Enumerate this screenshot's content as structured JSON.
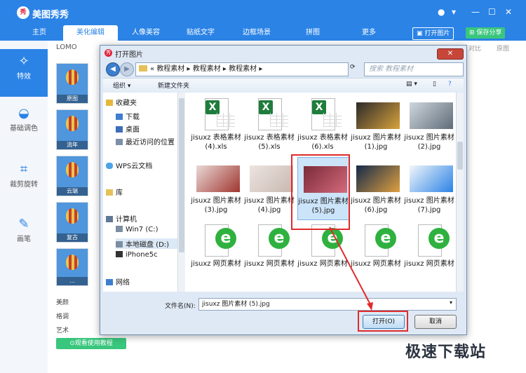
{
  "app": {
    "logo_text": "秀",
    "title": "美图秀秀",
    "controls": {
      "chat": "●",
      "menu": "▾",
      "minimize": "—",
      "maximize": "☐",
      "close": "✕"
    }
  },
  "tabs": [
    {
      "label": "主页"
    },
    {
      "label": "美化编辑"
    },
    {
      "label": "人像美容"
    },
    {
      "label": "贴纸文字"
    },
    {
      "label": "边框场景"
    },
    {
      "label": "拼图"
    },
    {
      "label": "更多"
    }
  ],
  "header_buttons": {
    "open": "打开图片",
    "save": "保存分享"
  },
  "sidebar": [
    {
      "label": "特效",
      "icon": "✧"
    },
    {
      "label": "基础调色",
      "icon": "◒"
    },
    {
      "label": "裁剪旋转",
      "icon": "⌗"
    },
    {
      "label": "画笔",
      "icon": "✎"
    }
  ],
  "effects": {
    "group": "LOMO",
    "thumbs": [
      "原图",
      "流年",
      "云端",
      "复古",
      "..."
    ],
    "categories": [
      "美颜",
      "格调",
      "艺术"
    ],
    "tutorial": "观看使用教程"
  },
  "top_right": {
    "compare": "对比",
    "contrast": "原图"
  },
  "dialog": {
    "title": "打开图片",
    "close": "✕",
    "nav": {
      "back": "◀",
      "forward": "▶"
    },
    "path": [
      "«",
      "教程素材",
      "▸",
      "教程素材",
      "▸",
      "教程素材",
      "▸"
    ],
    "search_placeholder": "搜索 教程素材",
    "toolbar": {
      "organize": "组织 ▾",
      "new_folder": "新建文件夹"
    },
    "nav_items": [
      {
        "label": "收藏夹",
        "color": "#e6b83a"
      },
      {
        "label": "下载",
        "color": "#3d7ed0"
      },
      {
        "label": "桌面",
        "color": "#3d6db8"
      },
      {
        "label": "最近访问的位置",
        "color": "#7c8fa6"
      },
      {
        "label": "WPS云文档",
        "color": "#4aa3e6"
      },
      {
        "label": "库",
        "color": "#e6c15a"
      },
      {
        "label": "计算机",
        "color": "#5f7896"
      },
      {
        "label": "Win7 (C:)",
        "color": "#7d8ea3"
      },
      {
        "label": "本地磁盘 (D:)",
        "color": "#7d8ea3"
      },
      {
        "label": "iPhone5c",
        "color": "#333333"
      },
      {
        "label": "网络",
        "color": "#3d7ed0"
      }
    ],
    "files": [
      {
        "name": "jisuxz 表格素材 (4).xls",
        "type": "xls"
      },
      {
        "name": "jisuxz 表格素材 (5).xls",
        "type": "xls"
      },
      {
        "name": "jisuxz 表格素材 (6).xls",
        "type": "xls"
      },
      {
        "name": "jisuxz 图片素材 (1).jpg",
        "type": "img",
        "colors": [
          "#2a2a2a",
          "#d9a23c"
        ]
      },
      {
        "name": "jisuxz 图片素材 (2).jpg",
        "type": "img",
        "colors": [
          "#cfd6dd",
          "#5f6c78"
        ]
      },
      {
        "name": "jisuxz 图片素材 (3).jpg",
        "type": "img",
        "colors": [
          "#e9d9d6",
          "#a1352f"
        ]
      },
      {
        "name": "jisuxz 图片素材 (4).jpg",
        "type": "img",
        "colors": [
          "#ece4e0",
          "#c8b8b0"
        ]
      },
      {
        "name": "jisuxz 图片素材 (5).jpg",
        "type": "img",
        "colors": [
          "#7a2a3a",
          "#d46a7a"
        ],
        "selected": true
      },
      {
        "name": "jisuxz 图片素材 (6).jpg",
        "type": "img",
        "colors": [
          "#132a4a",
          "#e0a040"
        ]
      },
      {
        "name": "jisuxz 图片素材 (7).jpg",
        "type": "img",
        "colors": [
          "#f2f6fa",
          "#2b83e6"
        ]
      },
      {
        "name": "jisuxz 网页素材",
        "type": "htm"
      },
      {
        "name": "jisuxz 网页素材",
        "type": "htm"
      },
      {
        "name": "jisuxz 网页素材",
        "type": "htm"
      },
      {
        "name": "jisuxz 网页素材",
        "type": "htm"
      },
      {
        "name": "jisuxz 网页素材",
        "type": "htm"
      }
    ],
    "filename_label": "文件名(N):",
    "filename_value": "jisuxz 图片素材 (5).jpg",
    "open": "打开(O)",
    "cancel": "取消"
  },
  "watermark": "极速下载站",
  "colors": {
    "accent": "#2b83e6",
    "highlight": "#e02b2b",
    "green": "#39c67d"
  }
}
